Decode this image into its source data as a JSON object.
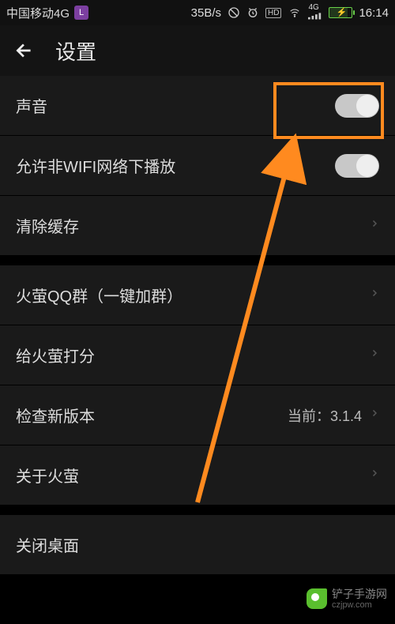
{
  "statusbar": {
    "carrier": "中国移动4G",
    "speed": "35B/s",
    "time": "16:14",
    "hd": "HD",
    "signal_label": "4G"
  },
  "header": {
    "title": "设置"
  },
  "rows": {
    "sound": {
      "label": "声音"
    },
    "nonwifi": {
      "label": "允许非WIFI网络下播放"
    },
    "clearcache": {
      "label": "清除缓存"
    },
    "qqgroup": {
      "label": "火萤QQ群（一键加群）"
    },
    "rate": {
      "label": "给火萤打分"
    },
    "update": {
      "label": "检查新版本",
      "value": "当前：3.1.4"
    },
    "about": {
      "label": "关于火萤"
    },
    "closedesktop": {
      "label": "关闭桌面"
    }
  },
  "watermark": {
    "name": "铲子手游网",
    "url": "czjpw.com"
  }
}
